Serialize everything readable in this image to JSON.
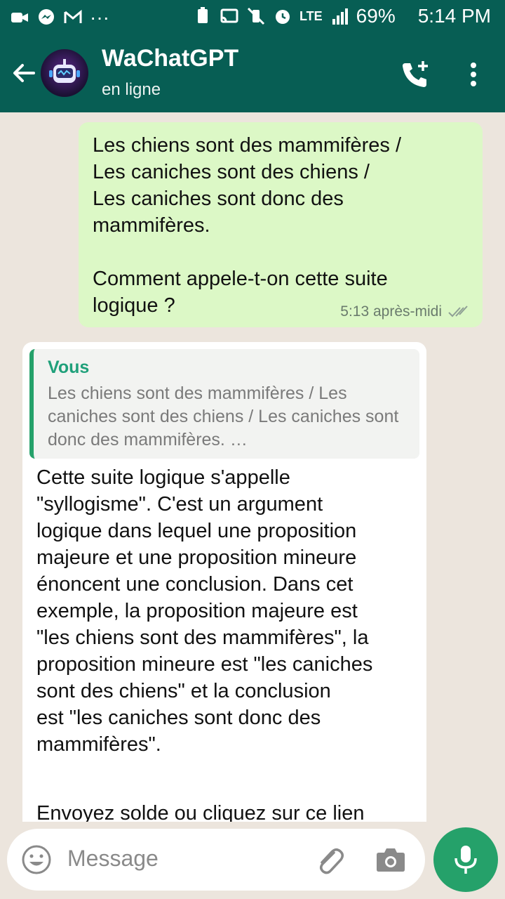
{
  "status_bar": {
    "network": "LTE",
    "battery": "69%",
    "time": "5:14 PM"
  },
  "header": {
    "title": "WaChatGPT",
    "subtitle": "en ligne"
  },
  "messages": {
    "outgoing": {
      "text": "Les chiens sont des mammifères /\nLes caniches sont des chiens /\nLes caniches sont donc des\nmammifères.\n\nComment appele-t-on cette suite\nlogique ?",
      "time": "5:13 après-midi"
    },
    "incoming": {
      "quote_author": "Vous",
      "quote_text": "Les chiens sont des mammifères / Les caniches sont des chiens / Les caniches sont donc des mammifères. …",
      "text": "Cette suite logique s'appelle\n\"syllogisme\". C'est un argument\nlogique dans lequel une proposition\nmajeure et une proposition mineure\nénoncent une conclusion. Dans cet\nexemple, la proposition majeure est\n\"les chiens sont des mammifères\", la\nproposition mineure est \"les caniches\nsont des chiens\" et la conclusion\nest \"les caniches sont donc des\nmammifères\".",
      "cutoff_text": "Envoyez solde ou cliquez sur ce lien"
    }
  },
  "composer": {
    "placeholder": "Message"
  },
  "colors": {
    "header": "#075e54",
    "accent": "#25a16a",
    "outgoing_bubble": "#dcf8c6",
    "chat_background": "#ece5dd"
  }
}
